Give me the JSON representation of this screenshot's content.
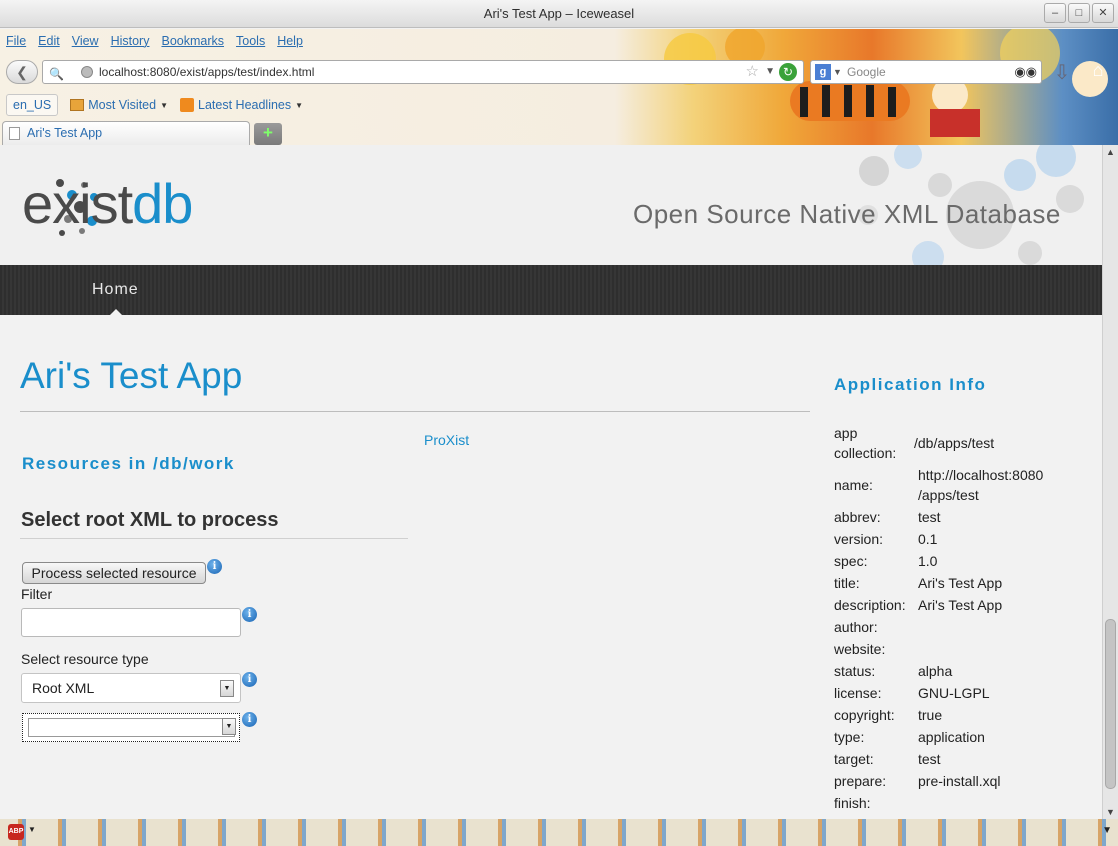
{
  "window": {
    "title": "Ari's Test App – Iceweasel",
    "controls": [
      "minimize-icon",
      "maximize-icon",
      "close-icon"
    ]
  },
  "menu": [
    "File",
    "Edit",
    "View",
    "History",
    "Bookmarks",
    "Tools",
    "Help"
  ],
  "urlbar": {
    "url": "localhost:8080/exist/apps/test/index.html"
  },
  "search": {
    "placeholder": "Google"
  },
  "bookmarks": {
    "lang": "en_US",
    "items": [
      {
        "label": "Most Visited",
        "icon": "folder-icon"
      },
      {
        "label": "Latest Headlines",
        "icon": "rss-icon"
      }
    ]
  },
  "tab": {
    "title": "Ari's Test App",
    "new_tab": "+"
  },
  "site": {
    "logo_text_a": "exist",
    "logo_text_b": "db",
    "tagline": "Open Source Native XML Database",
    "nav_home": "Home"
  },
  "main": {
    "title": "Ari's Test App",
    "link": "ProXist",
    "resources_heading": "Resources in /db/work",
    "select_heading": "Select root XML to process",
    "process_button": "Process selected resource",
    "filter_label": "Filter",
    "filter_value": "",
    "type_label": "Select resource type",
    "type_value": "Root XML",
    "info_glyph": "i"
  },
  "app_info": {
    "heading": "Application Info",
    "rows": [
      {
        "key": "app collection:",
        "value": "/db/apps/test"
      },
      {
        "key": "name:",
        "value": "http://localhost:8080 /apps/test"
      },
      {
        "key": "abbrev:",
        "value": "test"
      },
      {
        "key": "version:",
        "value": "0.1"
      },
      {
        "key": "spec:",
        "value": "1.0"
      },
      {
        "key": "title:",
        "value": "Ari's Test App"
      },
      {
        "key": "description:",
        "value": "Ari's Test App"
      },
      {
        "key": "author:",
        "value": ""
      },
      {
        "key": "website:",
        "value": ""
      },
      {
        "key": "status:",
        "value": "alpha"
      },
      {
        "key": "license:",
        "value": "GNU-LGPL"
      },
      {
        "key": "copyright:",
        "value": "true"
      },
      {
        "key": "type:",
        "value": "application"
      },
      {
        "key": "target:",
        "value": "test"
      },
      {
        "key": "prepare:",
        "value": "pre-install.xql"
      },
      {
        "key": "finish:",
        "value": ""
      }
    ]
  },
  "addonbar": {
    "abp": "ABP"
  },
  "colors": {
    "accent": "#1a8ecb",
    "nav_bg": "#2e2e2e",
    "page_bg": "#f2f2f2"
  }
}
